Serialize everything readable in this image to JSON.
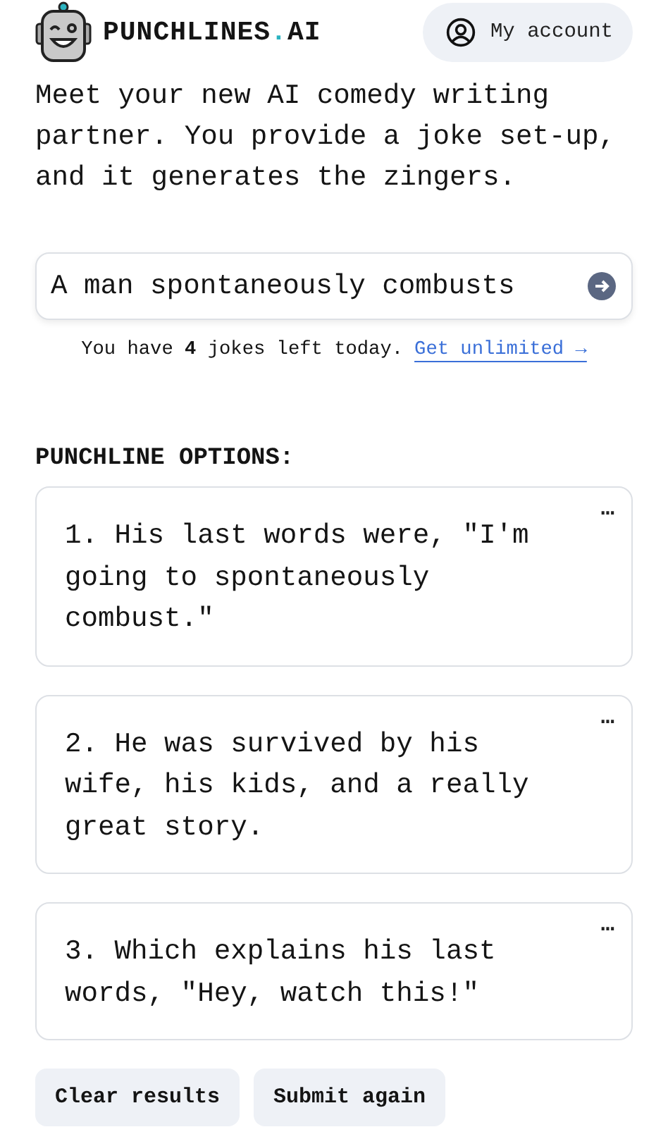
{
  "header": {
    "brand": "PUNCHLINES",
    "brand_dot": ".",
    "brand_suffix": "AI",
    "account_button": "My account"
  },
  "intro": "Meet your new AI comedy writing partner. You provide a joke set-up, and it generates the zingers.",
  "prompt": {
    "value": "A man spontaneously combusts"
  },
  "quota": {
    "text": "You have **4** jokes left today.",
    "link": "Get unlimited →"
  },
  "section_title": "PUNCHLINE OPTIONS:",
  "options": [
    {
      "text": "1. His last words were, \"I'm going to spontaneously combust.\"",
      "menu": "…"
    },
    {
      "text": "2. He was survived by his wife, his kids, and a really great story.",
      "menu": "…"
    },
    {
      "text": "3. Which explains his last words, \"Hey, watch this!\"",
      "menu": "…"
    }
  ],
  "buttons": [
    "Clear results",
    "Submit again"
  ]
}
